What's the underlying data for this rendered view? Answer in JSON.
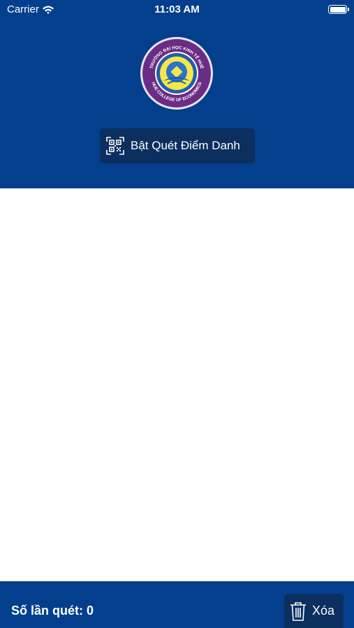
{
  "status_bar": {
    "carrier": "Carrier",
    "time": "11:03 AM",
    "wifi_icon": "wifi-icon",
    "battery_icon": "battery-icon"
  },
  "header": {
    "logo_top_text": "TRƯỜNG ĐẠI HỌC KINH TẾ HUẾ",
    "logo_bottom_text": "HUE COLLEGE OF ECONOMICS",
    "scan_button_label": "Bật Quét Điểm Danh",
    "scan_icon": "qr-scan-icon"
  },
  "footer": {
    "count_label": "Số lần quét: 0",
    "delete_button_label": "Xóa",
    "delete_icon": "trash-icon"
  },
  "colors": {
    "primary": "#033f8d",
    "button_bg": "#0b2f5f",
    "logo_yellow": "#f7e64a",
    "logo_blue": "#1f5fae"
  }
}
